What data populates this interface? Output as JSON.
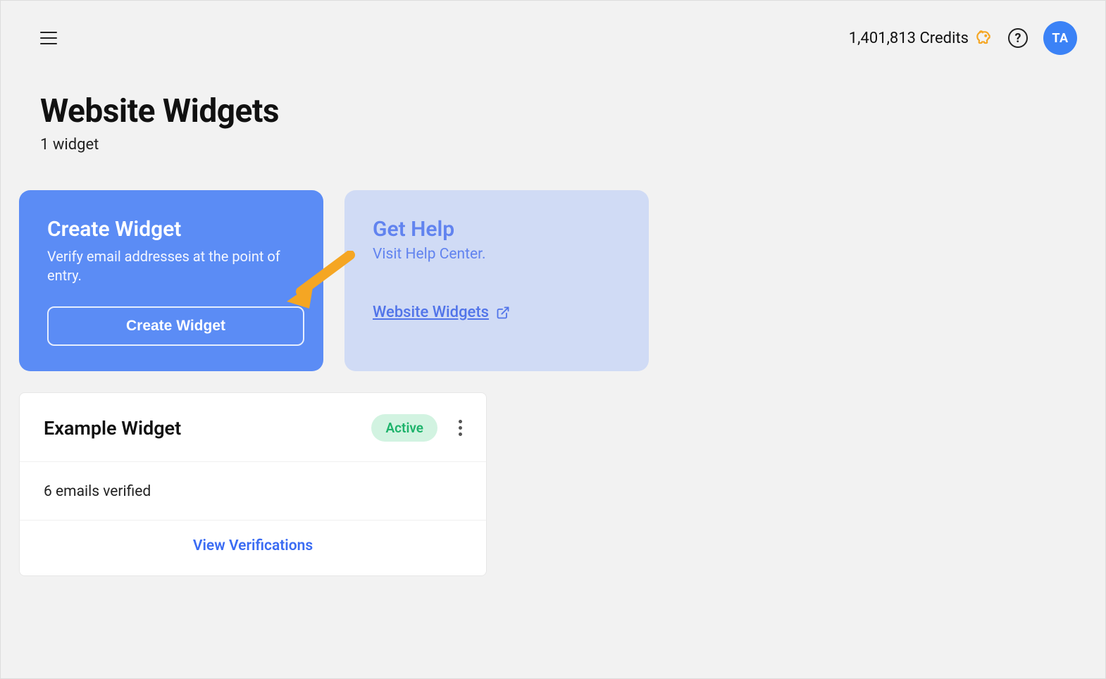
{
  "header": {
    "credits_text": "1,401,813 Credits",
    "avatar_initials": "TA"
  },
  "page": {
    "title": "Website Widgets",
    "subtitle": "1 widget"
  },
  "cards": {
    "create": {
      "title": "Create Widget",
      "description": "Verify email addresses at the point of entry.",
      "button_label": "Create Widget"
    },
    "help": {
      "title": "Get Help",
      "description": "Visit Help Center.",
      "link_label": "Website Widgets"
    }
  },
  "widget": {
    "name": "Example Widget",
    "status": "Active",
    "verified_text": "6 emails verified",
    "view_label": "View Verifications"
  }
}
